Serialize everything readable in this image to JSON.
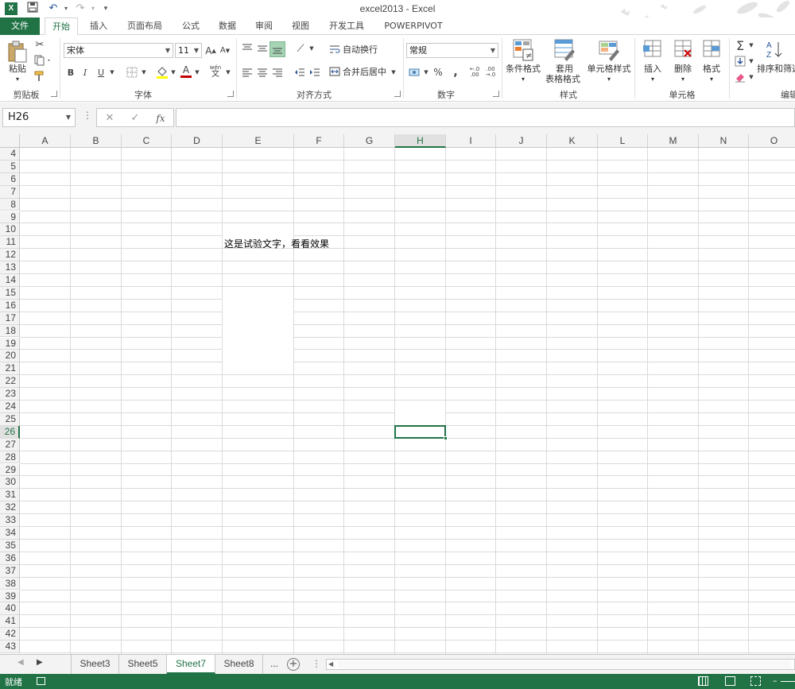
{
  "window": {
    "title": "excel2013 - Excel"
  },
  "ribbon_tabs": [
    "文件",
    "开始",
    "插入",
    "页面布局",
    "公式",
    "数据",
    "审阅",
    "视图",
    "开发工具",
    "POWERPIVOT"
  ],
  "active_tab": "开始",
  "clipboard": {
    "paste_label": "粘贴",
    "group_label": "剪贴板"
  },
  "font": {
    "name": "宋体",
    "size": "11",
    "group_label": "字体",
    "bold": "B",
    "italic": "I",
    "underline": "U",
    "grow": "A",
    "shrink": "A",
    "color_glyph": "A",
    "phonetic": "wén"
  },
  "alignment": {
    "wrap_text": "自动换行",
    "merge_center": "合并后居中",
    "group_label": "对齐方式"
  },
  "number": {
    "format": "常规",
    "percent": "%",
    "comma": ",",
    "group_label": "数字"
  },
  "styles": {
    "conditional": "条件格式",
    "table_format_1": "套用",
    "table_format_2": "表格格式",
    "cell_styles": "单元格样式",
    "group_label": "样式"
  },
  "cells": {
    "insert": "插入",
    "delete": "删除",
    "format": "格式",
    "group_label": "单元格"
  },
  "editing": {
    "sort_filter": "排序和筛选",
    "group_label": "编辑",
    "sum": "Σ"
  },
  "formula_bar": {
    "name_box": "H26",
    "fx": "fx",
    "cancel": "✕",
    "enter": "✓",
    "value": ""
  },
  "columns": [
    "A",
    "B",
    "C",
    "D",
    "E",
    "F",
    "G",
    "H",
    "I",
    "J",
    "K",
    "L",
    "M",
    "N",
    "O"
  ],
  "rows": [
    "4",
    "5",
    "6",
    "7",
    "8",
    "9",
    "10",
    "11",
    "12",
    "13",
    "14",
    "15",
    "16",
    "17",
    "18",
    "19",
    "20",
    "21",
    "22",
    "23",
    "24",
    "25",
    "26",
    "27",
    "28",
    "29",
    "30",
    "31",
    "32",
    "33",
    "34",
    "35",
    "36",
    "37",
    "38",
    "39",
    "40",
    "41",
    "42",
    "43"
  ],
  "selected_column": "H",
  "selected_row": "26",
  "cell_content": {
    "address": "E11",
    "text": "这是试验文字，看看效果"
  },
  "sheets": [
    "Sheet3",
    "Sheet5",
    "Sheet7",
    "Sheet8"
  ],
  "active_sheet": "Sheet7",
  "sheet_more": "...",
  "status": {
    "ready": "就绪"
  },
  "colors": {
    "accent": "#217346",
    "grid": "#dadada",
    "header_bg": "#f3f3f3"
  }
}
